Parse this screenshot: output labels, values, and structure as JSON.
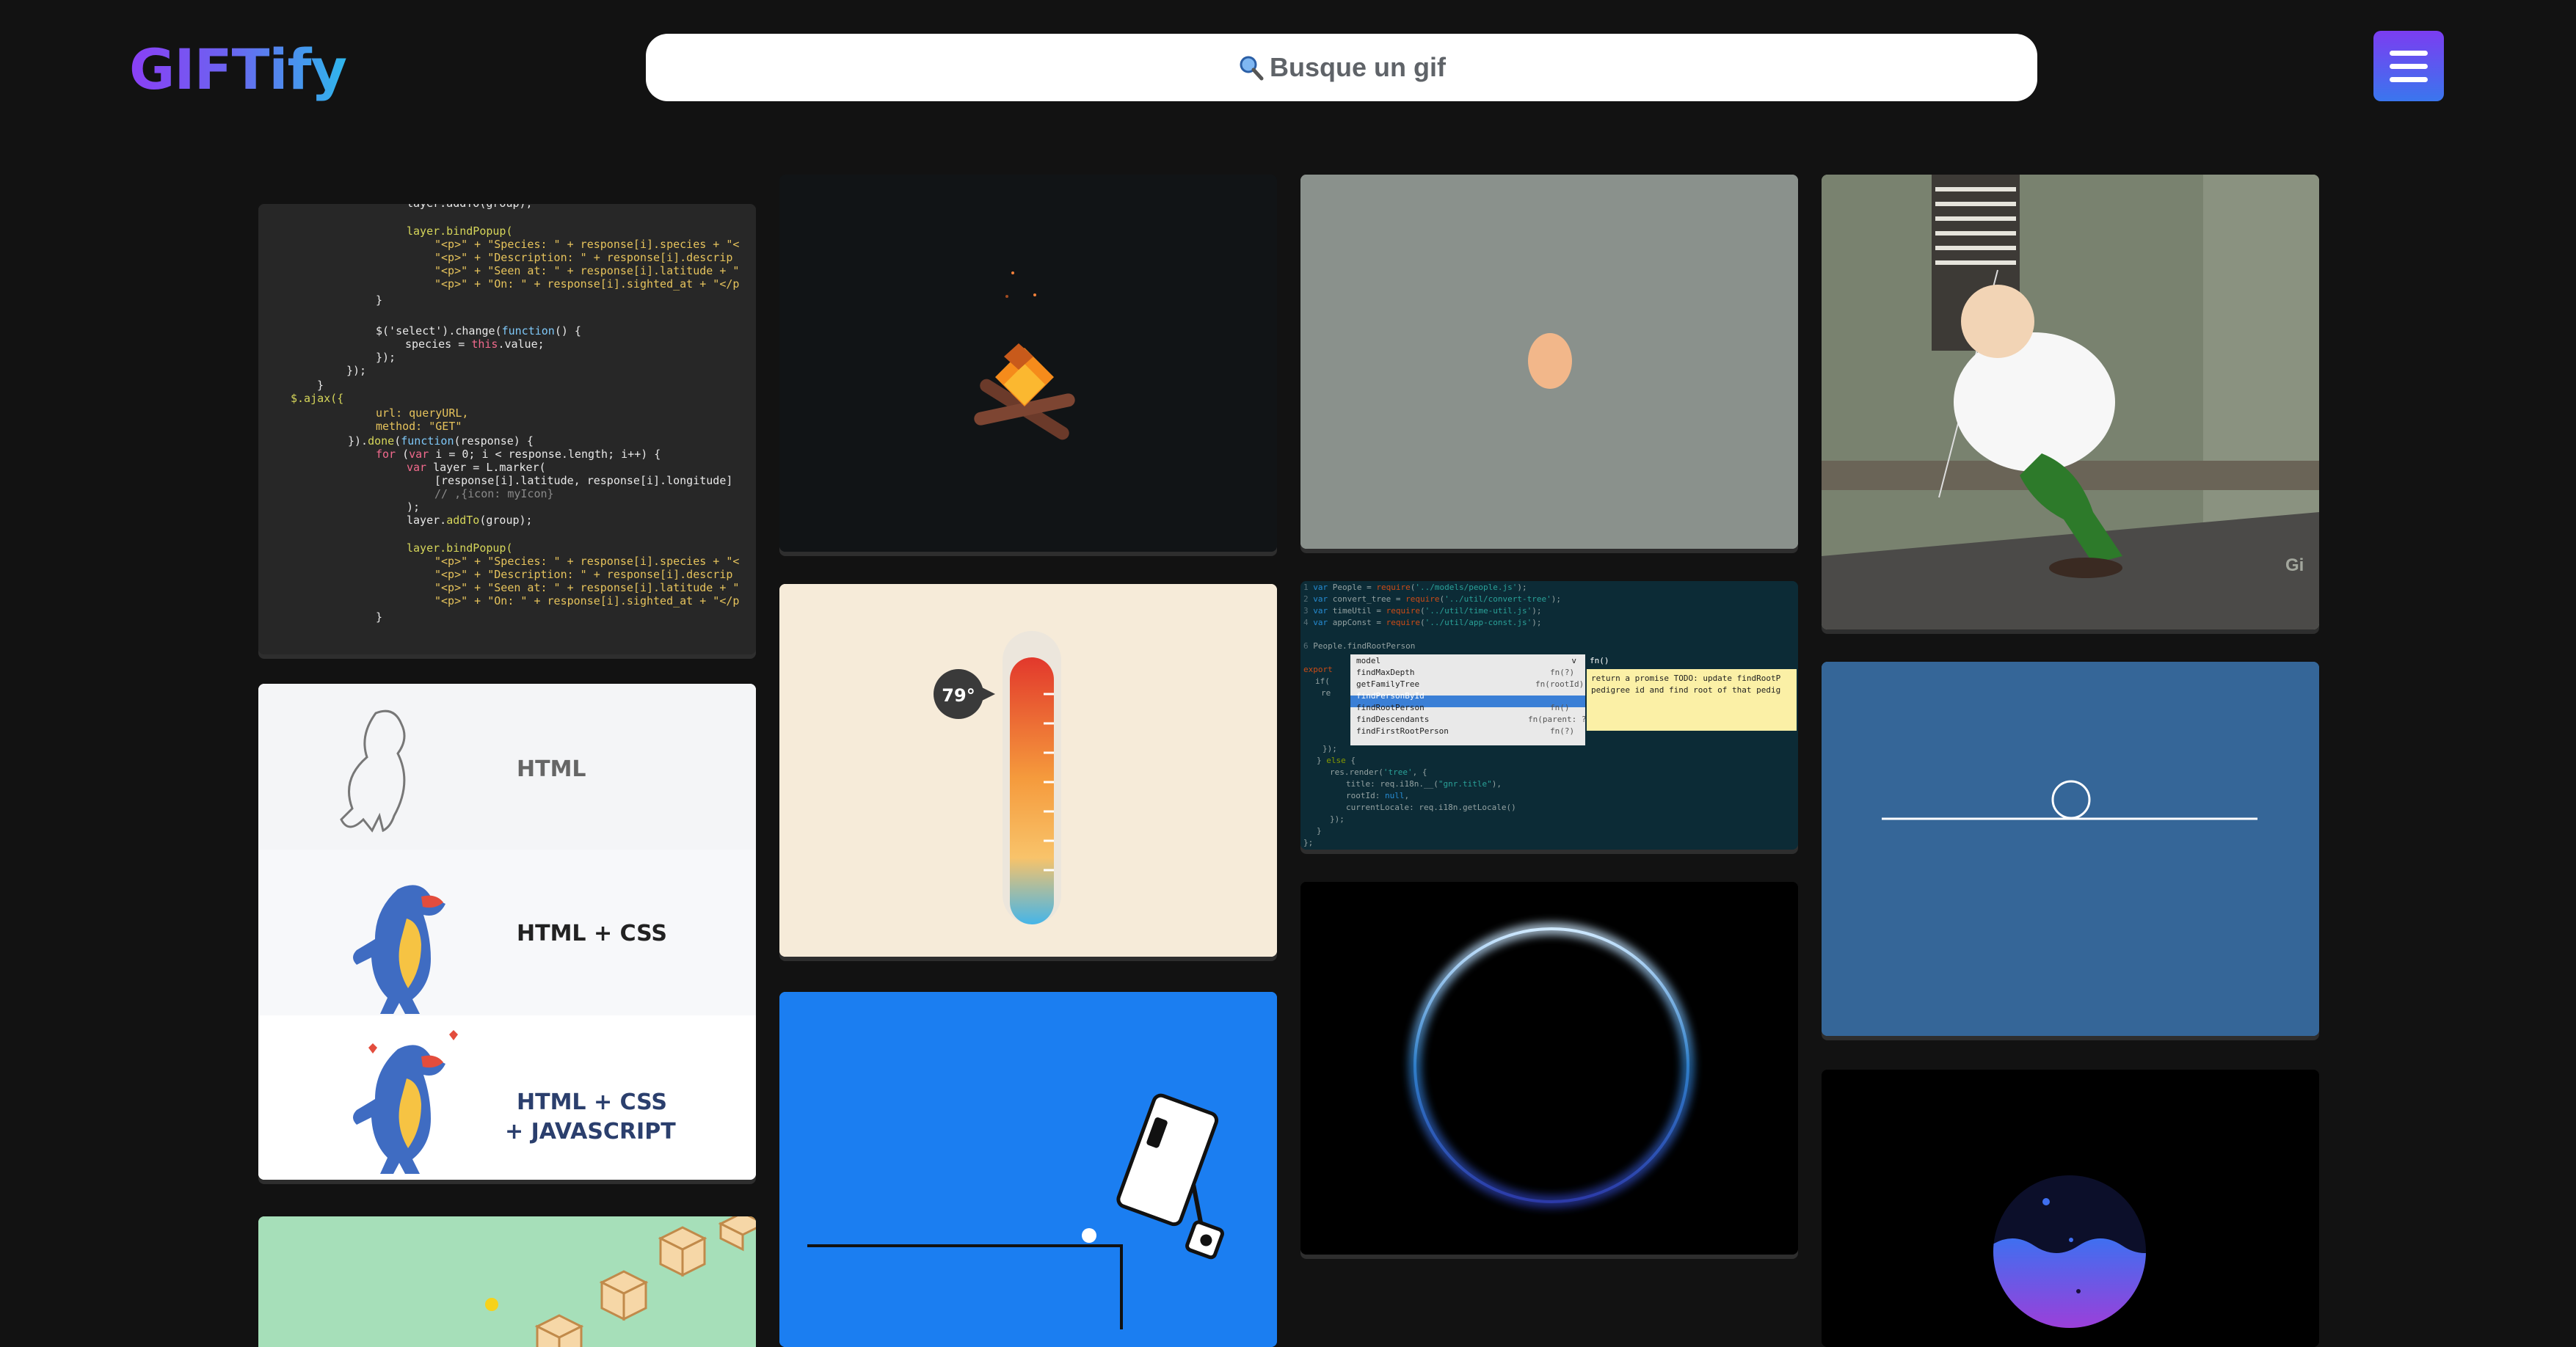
{
  "header": {
    "logo": "GIFTify",
    "search_placeholder": "Busque un gif",
    "search_icon": "magnifier-icon",
    "menu_icon": "hamburger-icon"
  },
  "colors": {
    "background": "#121212",
    "logo_gradient": [
      "#8a3ff5",
      "#2fb6ec"
    ],
    "menu_gradient": [
      "#7b3df1",
      "#3a76ee"
    ]
  },
  "gifs": {
    "thermometer": {
      "temperature": "79°"
    },
    "html_stages": {
      "stage1": "HTML",
      "stage2": "HTML + CSS",
      "stage3_a": "HTML + CSS",
      "stage3_b": "+ JAVASCRIPT"
    },
    "peter_watermark": "Gi"
  }
}
